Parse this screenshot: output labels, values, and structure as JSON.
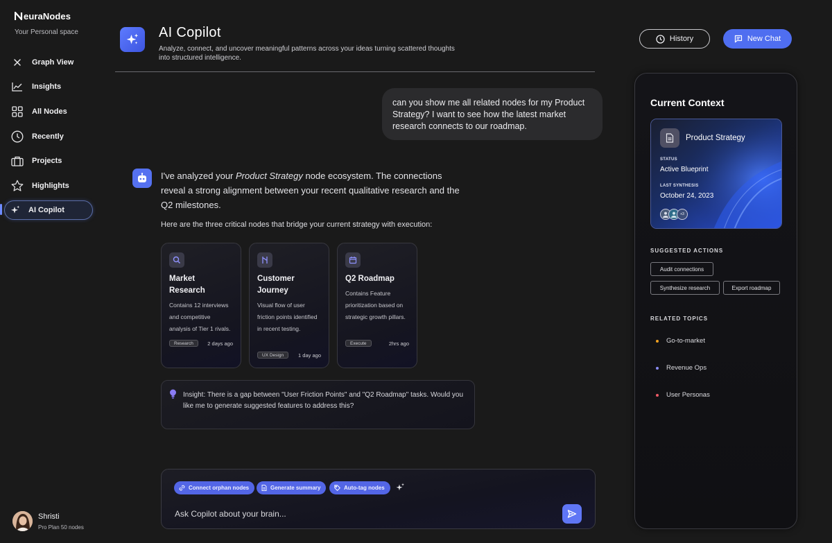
{
  "brand": {
    "name": "euraNodes",
    "subtitle": "Your Personal space"
  },
  "sidebar": {
    "items": [
      {
        "label": "Graph View",
        "icon": "close-x-icon"
      },
      {
        "label": "Insights",
        "icon": "line-chart-icon"
      },
      {
        "label": "All Nodes",
        "icon": "grid-icon"
      },
      {
        "label": "Recently",
        "icon": "clock-icon"
      },
      {
        "label": "Projects",
        "icon": "briefcase-icon"
      },
      {
        "label": "Highlights",
        "icon": "star-icon"
      },
      {
        "label": "AI Copilot",
        "icon": "sparkles-icon",
        "active": true
      }
    ],
    "user": {
      "name": "Shristi",
      "plan": "Pro Plan 50 nodes"
    }
  },
  "header": {
    "title": "AI Copilot",
    "description": "Analyze, connect, and uncover meaningful patterns across your ideas turning scattered thoughts into structured intelligence.",
    "history_label": "History",
    "new_chat_label": "New Chat"
  },
  "chat": {
    "user_message": "can you show me all related nodes for my Product Strategy? I want to see how the latest market research connects to our roadmap.",
    "bot_message": {
      "prefix": "I've analyzed your ",
      "emphasis": "Product Strategy",
      "suffix": " node ecosystem. The connections reveal a strong alignment between your recent qualitative research and the Q2 milestones."
    },
    "bot_sub": "Here are the three critical nodes that bridge your current strategy with execution:",
    "nodes": [
      {
        "title": "Market Research",
        "description": "Contains 12 interviews and competitive analysis of Tier 1 rivals.",
        "tag": "Research",
        "age": "2 days ago",
        "icon": "search-icon"
      },
      {
        "title": "Customer Journey",
        "description": "Visual flow of user friction points identified in recent testing.",
        "tag": "UX Design",
        "age": "1 day ago",
        "icon": "route-icon"
      },
      {
        "title": "Q2 Roadmap",
        "description": "Contains Feature prioritization based on strategic growth pillars.",
        "tag": "Execute",
        "age": "2hrs ago",
        "icon": "calendar-icon"
      }
    ],
    "insight": "Insight: There is a gap between \"User Friction Points\" and \"Q2 Roadmap\" tasks. Would you like me to generate suggested features to address this?"
  },
  "composer": {
    "chips": [
      "Connect orphan nodes",
      "Generate summary",
      "Auto-tag nodes"
    ],
    "placeholder": "Ask Copilot about your brain..."
  },
  "context": {
    "title": "Current Context",
    "card": {
      "name": "Product Strategy",
      "status_label": "STATUS",
      "status_value": "Active Blueprint",
      "synth_label": "LAST SYNTHESIS",
      "synth_value": "October 24, 2023",
      "avatar_more": "+3"
    },
    "suggested_label": "SUGGESTED ACTIONS",
    "actions": [
      "Audit connections",
      "Synthesize research",
      "Export roadmap"
    ],
    "related_label": "RELATED TOPICS",
    "topics": [
      {
        "label": "Go-to-market",
        "color": "#f0a020"
      },
      {
        "label": "Revenue Ops",
        "color": "#8a8cf5"
      },
      {
        "label": "User Personas",
        "color": "#ee5a66"
      }
    ]
  },
  "colors": {
    "accent": "#4f6ef0",
    "background": "#1a1a1a",
    "panel": "#121215"
  }
}
